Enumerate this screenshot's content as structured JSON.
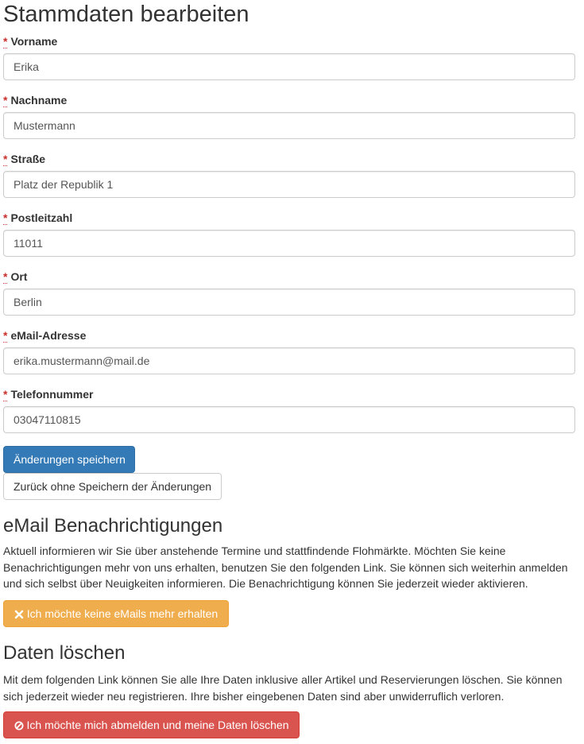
{
  "page_title": "Stammdaten bearbeiten",
  "required_marker": "*",
  "fields": [
    {
      "label": "Vorname",
      "value": "Erika"
    },
    {
      "label": "Nachname",
      "value": "Mustermann"
    },
    {
      "label": "Straße",
      "value": "Platz der Republik 1"
    },
    {
      "label": "Postleitzahl",
      "value": "11011"
    },
    {
      "label": "Ort",
      "value": "Berlin"
    },
    {
      "label": "eMail-Adresse",
      "value": "erika.mustermann@mail.de"
    },
    {
      "label": "Telefonnummer",
      "value": "03047110815"
    }
  ],
  "buttons": {
    "save": "Änderungen speichern",
    "back": "Zurück ohne Speichern der Änderungen"
  },
  "notifications": {
    "heading": "eMail Benachrichtigungen",
    "text": "Aktuell informieren wir Sie über anstehende Termine und stattfindende Flohmärkte. Möchten Sie keine Benachrichtigungen mehr von uns erhalten, benutzen Sie den folgenden Link. Sie können sich weiterhin anmelden und sich selbst über Neuigkeiten informieren. Die Benachrichtigung können Sie jederzeit wieder aktivieren.",
    "button": "Ich möchte keine eMails mehr erhalten",
    "button_icon": "close-icon"
  },
  "delete": {
    "heading": "Daten löschen",
    "text": "Mit dem folgenden Link können Sie alle Ihre Daten inklusive aller Artikel und Reservierungen löschen. Sie können sich jederzeit wieder neu registrieren. Ihre bisher eingebenen Daten sind aber unwiderruflich verloren.",
    "button": "Ich möchte mich abmelden und meine Daten löschen",
    "button_icon": "ban-icon"
  },
  "colors": {
    "primary": "#337ab7",
    "warning": "#f0ad4e",
    "danger": "#d9534f",
    "required": "#c9302c"
  }
}
